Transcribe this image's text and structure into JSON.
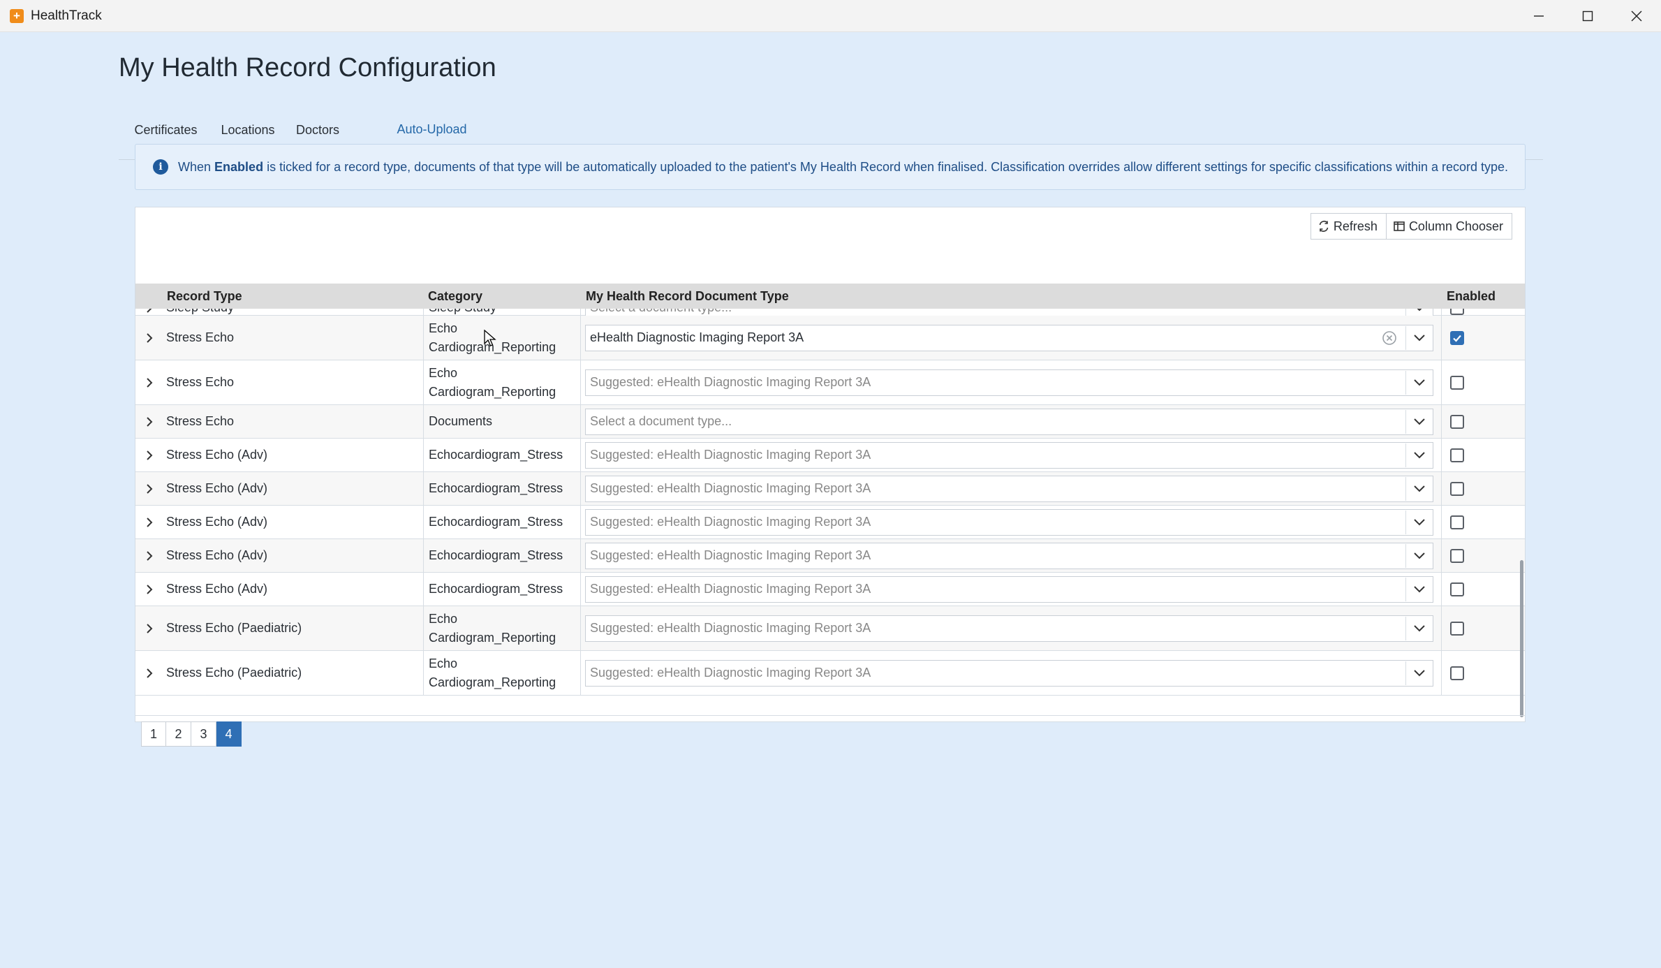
{
  "window": {
    "title": "HealthTrack"
  },
  "page": {
    "title": "My Health Record Configuration"
  },
  "tabs": [
    {
      "label": "Certificates"
    },
    {
      "label": "Locations"
    },
    {
      "label": "Doctors"
    },
    {
      "label": "Auto-Upload"
    }
  ],
  "active_tab": "Auto-Upload",
  "info": {
    "prefix": "When",
    "bold": "Enabled",
    "text": "is ticked for a record type, documents of that type will be automatically uploaded to the patient's My Health Record when finalised. Classification overrides allow different settings for specific classifications within a record type."
  },
  "toolbar": {
    "refresh_label": "Refresh",
    "column_chooser_label": "Column Chooser"
  },
  "grid": {
    "columns": [
      "Record Type",
      "Category",
      "My Health Record Document Type",
      "Enabled"
    ],
    "rows": [
      {
        "record_type": "Sleep Study",
        "category": "Sleep Study",
        "doc_type": "Select a document type...",
        "doc_is_value": false,
        "enabled": false
      },
      {
        "record_type": "Stress Echo",
        "category": "Echo Cardiogram_Reporting",
        "doc_type": "eHealth Diagnostic Imaging Report 3A",
        "doc_is_value": true,
        "enabled": true
      },
      {
        "record_type": "Stress Echo",
        "category": "Echo Cardiogram_Reporting",
        "doc_type": "Suggested: eHealth Diagnostic Imaging Report 3A",
        "doc_is_value": false,
        "enabled": false
      },
      {
        "record_type": "Stress Echo",
        "category": "Documents",
        "doc_type": "Select a document type...",
        "doc_is_value": false,
        "enabled": false
      },
      {
        "record_type": "Stress Echo (Adv)",
        "category": "Echocardiogram_Stress",
        "doc_type": "Suggested: eHealth Diagnostic Imaging Report 3A",
        "doc_is_value": false,
        "enabled": false
      },
      {
        "record_type": "Stress Echo (Adv)",
        "category": "Echocardiogram_Stress",
        "doc_type": "Suggested: eHealth Diagnostic Imaging Report 3A",
        "doc_is_value": false,
        "enabled": false
      },
      {
        "record_type": "Stress Echo (Adv)",
        "category": "Echocardiogram_Stress",
        "doc_type": "Suggested: eHealth Diagnostic Imaging Report 3A",
        "doc_is_value": false,
        "enabled": false
      },
      {
        "record_type": "Stress Echo (Adv)",
        "category": "Echocardiogram_Stress",
        "doc_type": "Suggested: eHealth Diagnostic Imaging Report 3A",
        "doc_is_value": false,
        "enabled": false
      },
      {
        "record_type": "Stress Echo (Adv)",
        "category": "Echocardiogram_Stress",
        "doc_type": "Suggested: eHealth Diagnostic Imaging Report 3A",
        "doc_is_value": false,
        "enabled": false
      },
      {
        "record_type": "Stress Echo (Paediatric)",
        "category": "Echo Cardiogram_Reporting",
        "doc_type": "Suggested: eHealth Diagnostic Imaging Report 3A",
        "doc_is_value": false,
        "enabled": false
      },
      {
        "record_type": "Stress Echo (Paediatric)",
        "category": "Echo Cardiogram_Reporting",
        "doc_type": "Suggested: eHealth Diagnostic Imaging Report 3A",
        "doc_is_value": false,
        "enabled": false
      }
    ]
  },
  "pager": {
    "pages": [
      "1",
      "2",
      "3",
      "4"
    ],
    "current": "4"
  },
  "colors": {
    "accent": "#2f6fb5",
    "background": "#dfecfa",
    "info_text": "#1e4d86"
  }
}
